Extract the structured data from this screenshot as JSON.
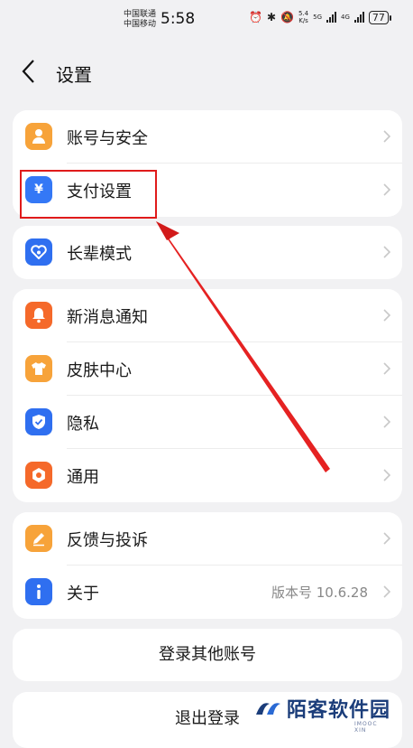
{
  "status_bar": {
    "carrier_1": "中国联通",
    "carrier_2": "中国移动",
    "time": "5:58",
    "net_speed_value": "5.4",
    "net_speed_unit": "K/s",
    "sim1": "5G",
    "sim2": "4G",
    "battery": "77"
  },
  "header": {
    "title": "设置"
  },
  "groups": [
    {
      "items": [
        {
          "label": "账号与安全",
          "icon": "user-icon",
          "color": "#f7a33a"
        },
        {
          "label": "支付设置",
          "icon": "yuan-icon",
          "color": "#3478f6"
        }
      ]
    },
    {
      "items": [
        {
          "label": "长辈模式",
          "icon": "heart-icon",
          "color": "#2f6ff0"
        }
      ]
    },
    {
      "items": [
        {
          "label": "新消息通知",
          "icon": "bell-icon",
          "color": "#f5692a"
        },
        {
          "label": "皮肤中心",
          "icon": "shirt-icon",
          "color": "#f7a33a"
        },
        {
          "label": "隐私",
          "icon": "shield-icon",
          "color": "#2f6ff0"
        },
        {
          "label": "通用",
          "icon": "gear-icon",
          "color": "#f5692a"
        }
      ]
    },
    {
      "items": [
        {
          "label": "反馈与投诉",
          "icon": "edit-icon",
          "color": "#f7a33a"
        },
        {
          "label": "关于",
          "icon": "info-icon",
          "color": "#2f6ff0",
          "value": "版本号 10.6.28"
        }
      ]
    }
  ],
  "buttons": {
    "other_account": "登录其他账号",
    "logout": "退出登录"
  },
  "watermark": {
    "name": "陌客软件园",
    "sub": "IMOOC XIN"
  },
  "annotation_color": "#e01b1b"
}
